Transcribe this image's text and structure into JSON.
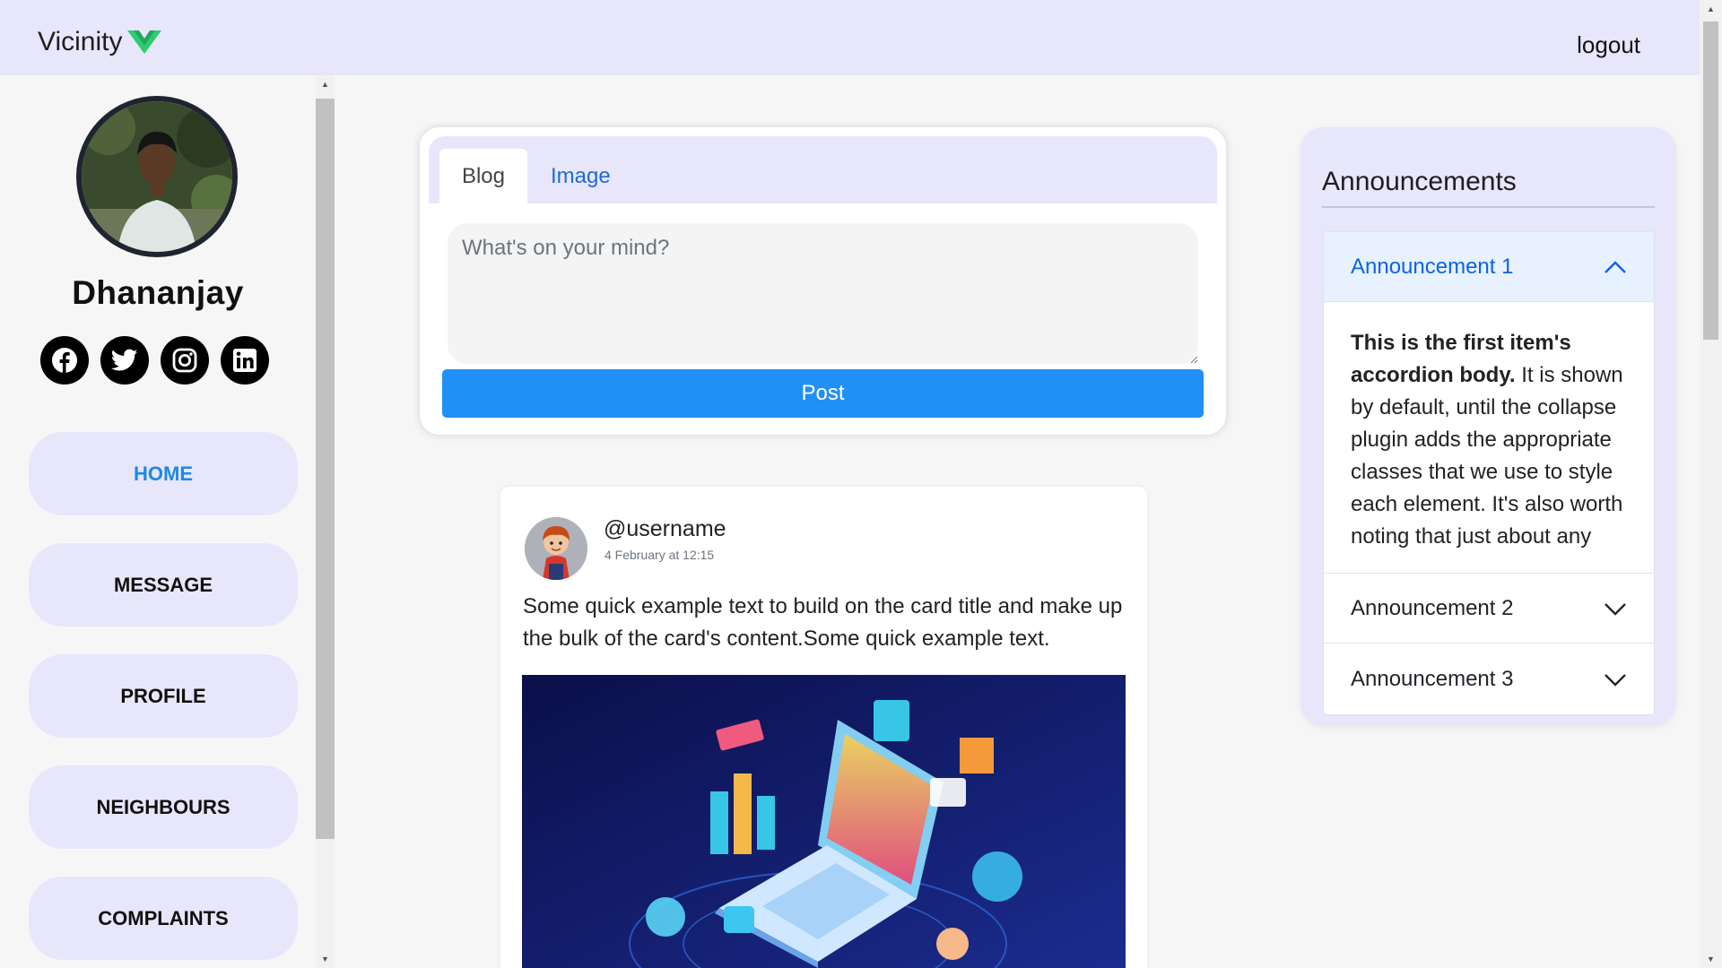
{
  "brand": {
    "name": "Vicinity",
    "logo_color": "#2ecc71"
  },
  "header": {
    "logout_label": "logout"
  },
  "profile": {
    "name": "Dhananjay"
  },
  "socials": [
    "facebook-icon",
    "twitter-icon",
    "instagram-icon",
    "linkedin-icon"
  ],
  "nav": {
    "items": [
      {
        "label": "HOME",
        "active": true
      },
      {
        "label": "MESSAGE"
      },
      {
        "label": "PROFILE"
      },
      {
        "label": "NEIGHBOURS"
      },
      {
        "label": "COMPLAINTS"
      }
    ]
  },
  "composer": {
    "tabs": [
      {
        "label": "Blog",
        "active": true
      },
      {
        "label": "Image"
      }
    ],
    "placeholder": "What's on your mind?",
    "post_label": "Post"
  },
  "post": {
    "username": "@username",
    "date": "4 February at 12:15",
    "text": "Some quick example text to build on the card title and make up the bulk of the card's content.Some quick example text."
  },
  "announcements": {
    "title": "Announcements",
    "items": [
      {
        "title": "Announcement 1",
        "expanded": true,
        "body_bold": "This is the first item's accordion body.",
        "body": " It is shown by default, until the collapse plugin adds the appropriate classes that we use to style each element. It's also worth noting that just about any"
      },
      {
        "title": "Announcement 2",
        "expanded": false
      },
      {
        "title": "Announcement 3",
        "expanded": false
      }
    ]
  },
  "colors": {
    "accent": "#2190f6",
    "nav_bg": "#e8e6fb",
    "link": "#1e6bd6",
    "accordion_active": "#0c63e4"
  }
}
